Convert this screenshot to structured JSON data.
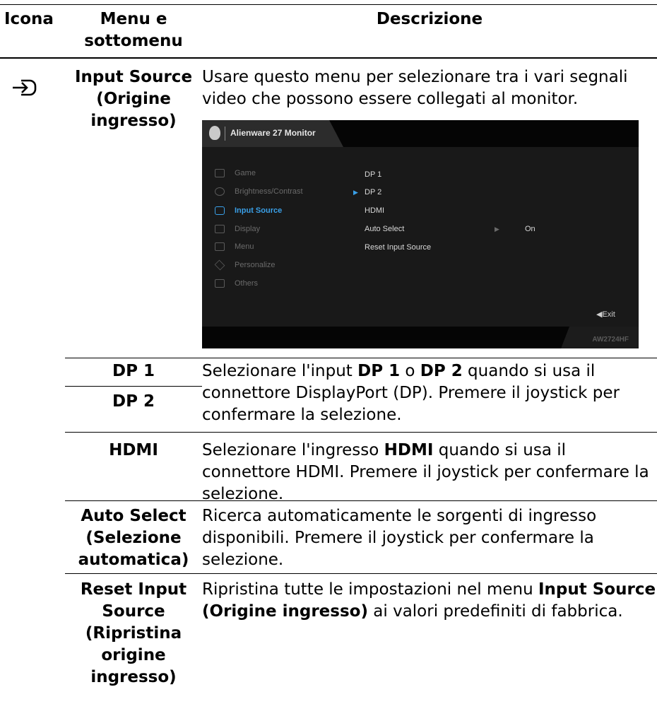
{
  "header": {
    "icon": "Icona",
    "menu": "Menu e sottomenu",
    "description": "Descrizione"
  },
  "row_input_source": {
    "icon_name": "input-source-icon",
    "menu": "Input Source (Origine ingresso)",
    "description": "Usare questo menu per selezionare tra i vari segnali video che possono essere collegati al monitor."
  },
  "osd": {
    "title": "Alienware 27 Monitor",
    "model": "AW2724HF",
    "left_menu": [
      {
        "label": "Game",
        "icon": "gamepad-icon",
        "active": false
      },
      {
        "label": "Brightness/Contrast",
        "icon": "brightness-icon",
        "active": false
      },
      {
        "label": "Input Source",
        "icon": "input-source-icon",
        "active": true
      },
      {
        "label": "Display",
        "icon": "display-icon",
        "active": false
      },
      {
        "label": "Menu",
        "icon": "menu-icon",
        "active": false
      },
      {
        "label": "Personalize",
        "icon": "star-icon",
        "active": false
      },
      {
        "label": "Others",
        "icon": "others-icon",
        "active": false
      }
    ],
    "right_menu": [
      "DP 1",
      "DP 2",
      "HDMI",
      "Auto Select",
      "Reset Input Source"
    ],
    "selected_item": "DP 2",
    "auto_select_value": "On",
    "exit": "Exit",
    "accent_color": "#3aa0e8"
  },
  "rows": {
    "dp1": "DP 1",
    "dp2": "DP 2",
    "dp_desc": {
      "t1": "Selezionare l'input ",
      "b1": "DP 1",
      "t2": " o ",
      "b2": "DP 2",
      "t3": " quando si usa il connettore DisplayPort (DP). Premere il joystick per confermare la selezione."
    },
    "hdmi": "HDMI",
    "hdmi_desc": {
      "t1": "Selezionare l'ingresso ",
      "b1": "HDMI",
      "t2": " quando si usa il connettore HDMI. Premere il joystick per confermare la selezione."
    },
    "auto_select": "Auto Select (Selezione automatica)",
    "auto_select_desc": "Ricerca automaticamente le sorgenti di ingresso disponibili. Premere il joystick per confermare la selezione.",
    "reset": "Reset Input Source (Ripristina origine ingresso)",
    "reset_desc": {
      "t1": "Ripristina tutte le impostazioni nel menu ",
      "b1": "Input Source (Origine ingresso)",
      "t2": " ai valori predefiniti di fabbrica."
    }
  }
}
